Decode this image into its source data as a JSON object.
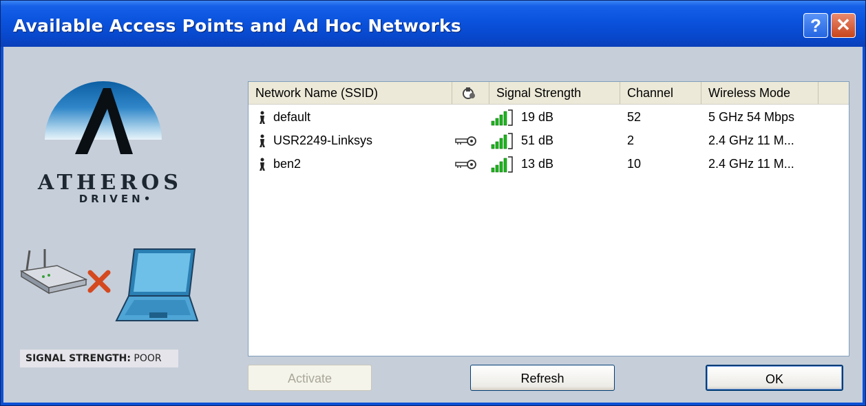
{
  "window": {
    "title": "Available Access Points and Ad Hoc Networks",
    "help_label": "?",
    "close_label": "✕"
  },
  "logo": {
    "brand": "ATHEROS",
    "tagline": "DRIVEN",
    "trademark": "•"
  },
  "status": {
    "label": "SIGNAL STRENGTH:",
    "value": "POOR"
  },
  "list": {
    "columns": [
      "Network Name (SSID)",
      "",
      "Signal Strength",
      "Channel",
      "Wireless Mode"
    ],
    "rows": [
      {
        "ssid": "default",
        "secured": false,
        "signal": "19 dB",
        "channel": "52",
        "mode": "5 GHz 54 Mbps"
      },
      {
        "ssid": "USR2249-Linksys",
        "secured": true,
        "signal": "51 dB",
        "channel": "2",
        "mode": "2.4 GHz 11 M..."
      },
      {
        "ssid": "ben2",
        "secured": true,
        "signal": "13 dB",
        "channel": "10",
        "mode": "2.4 GHz 11 M..."
      }
    ]
  },
  "buttons": {
    "activate": "Activate",
    "refresh": "Refresh",
    "ok": "OK"
  },
  "icons": {
    "help": "help-icon",
    "close": "close-icon",
    "security_header": "security-column-icon",
    "network": "network-person-icon",
    "key": "key-icon",
    "signal": "signal-bars-icon",
    "router": "router-icon",
    "disconnected": "x-mark-icon",
    "laptop": "laptop-icon"
  },
  "colors": {
    "titlebar": "#0a52dc",
    "panel": "#c6ced9",
    "signal_green": "#1fb61f",
    "disconnected_red": "#d5491f"
  }
}
